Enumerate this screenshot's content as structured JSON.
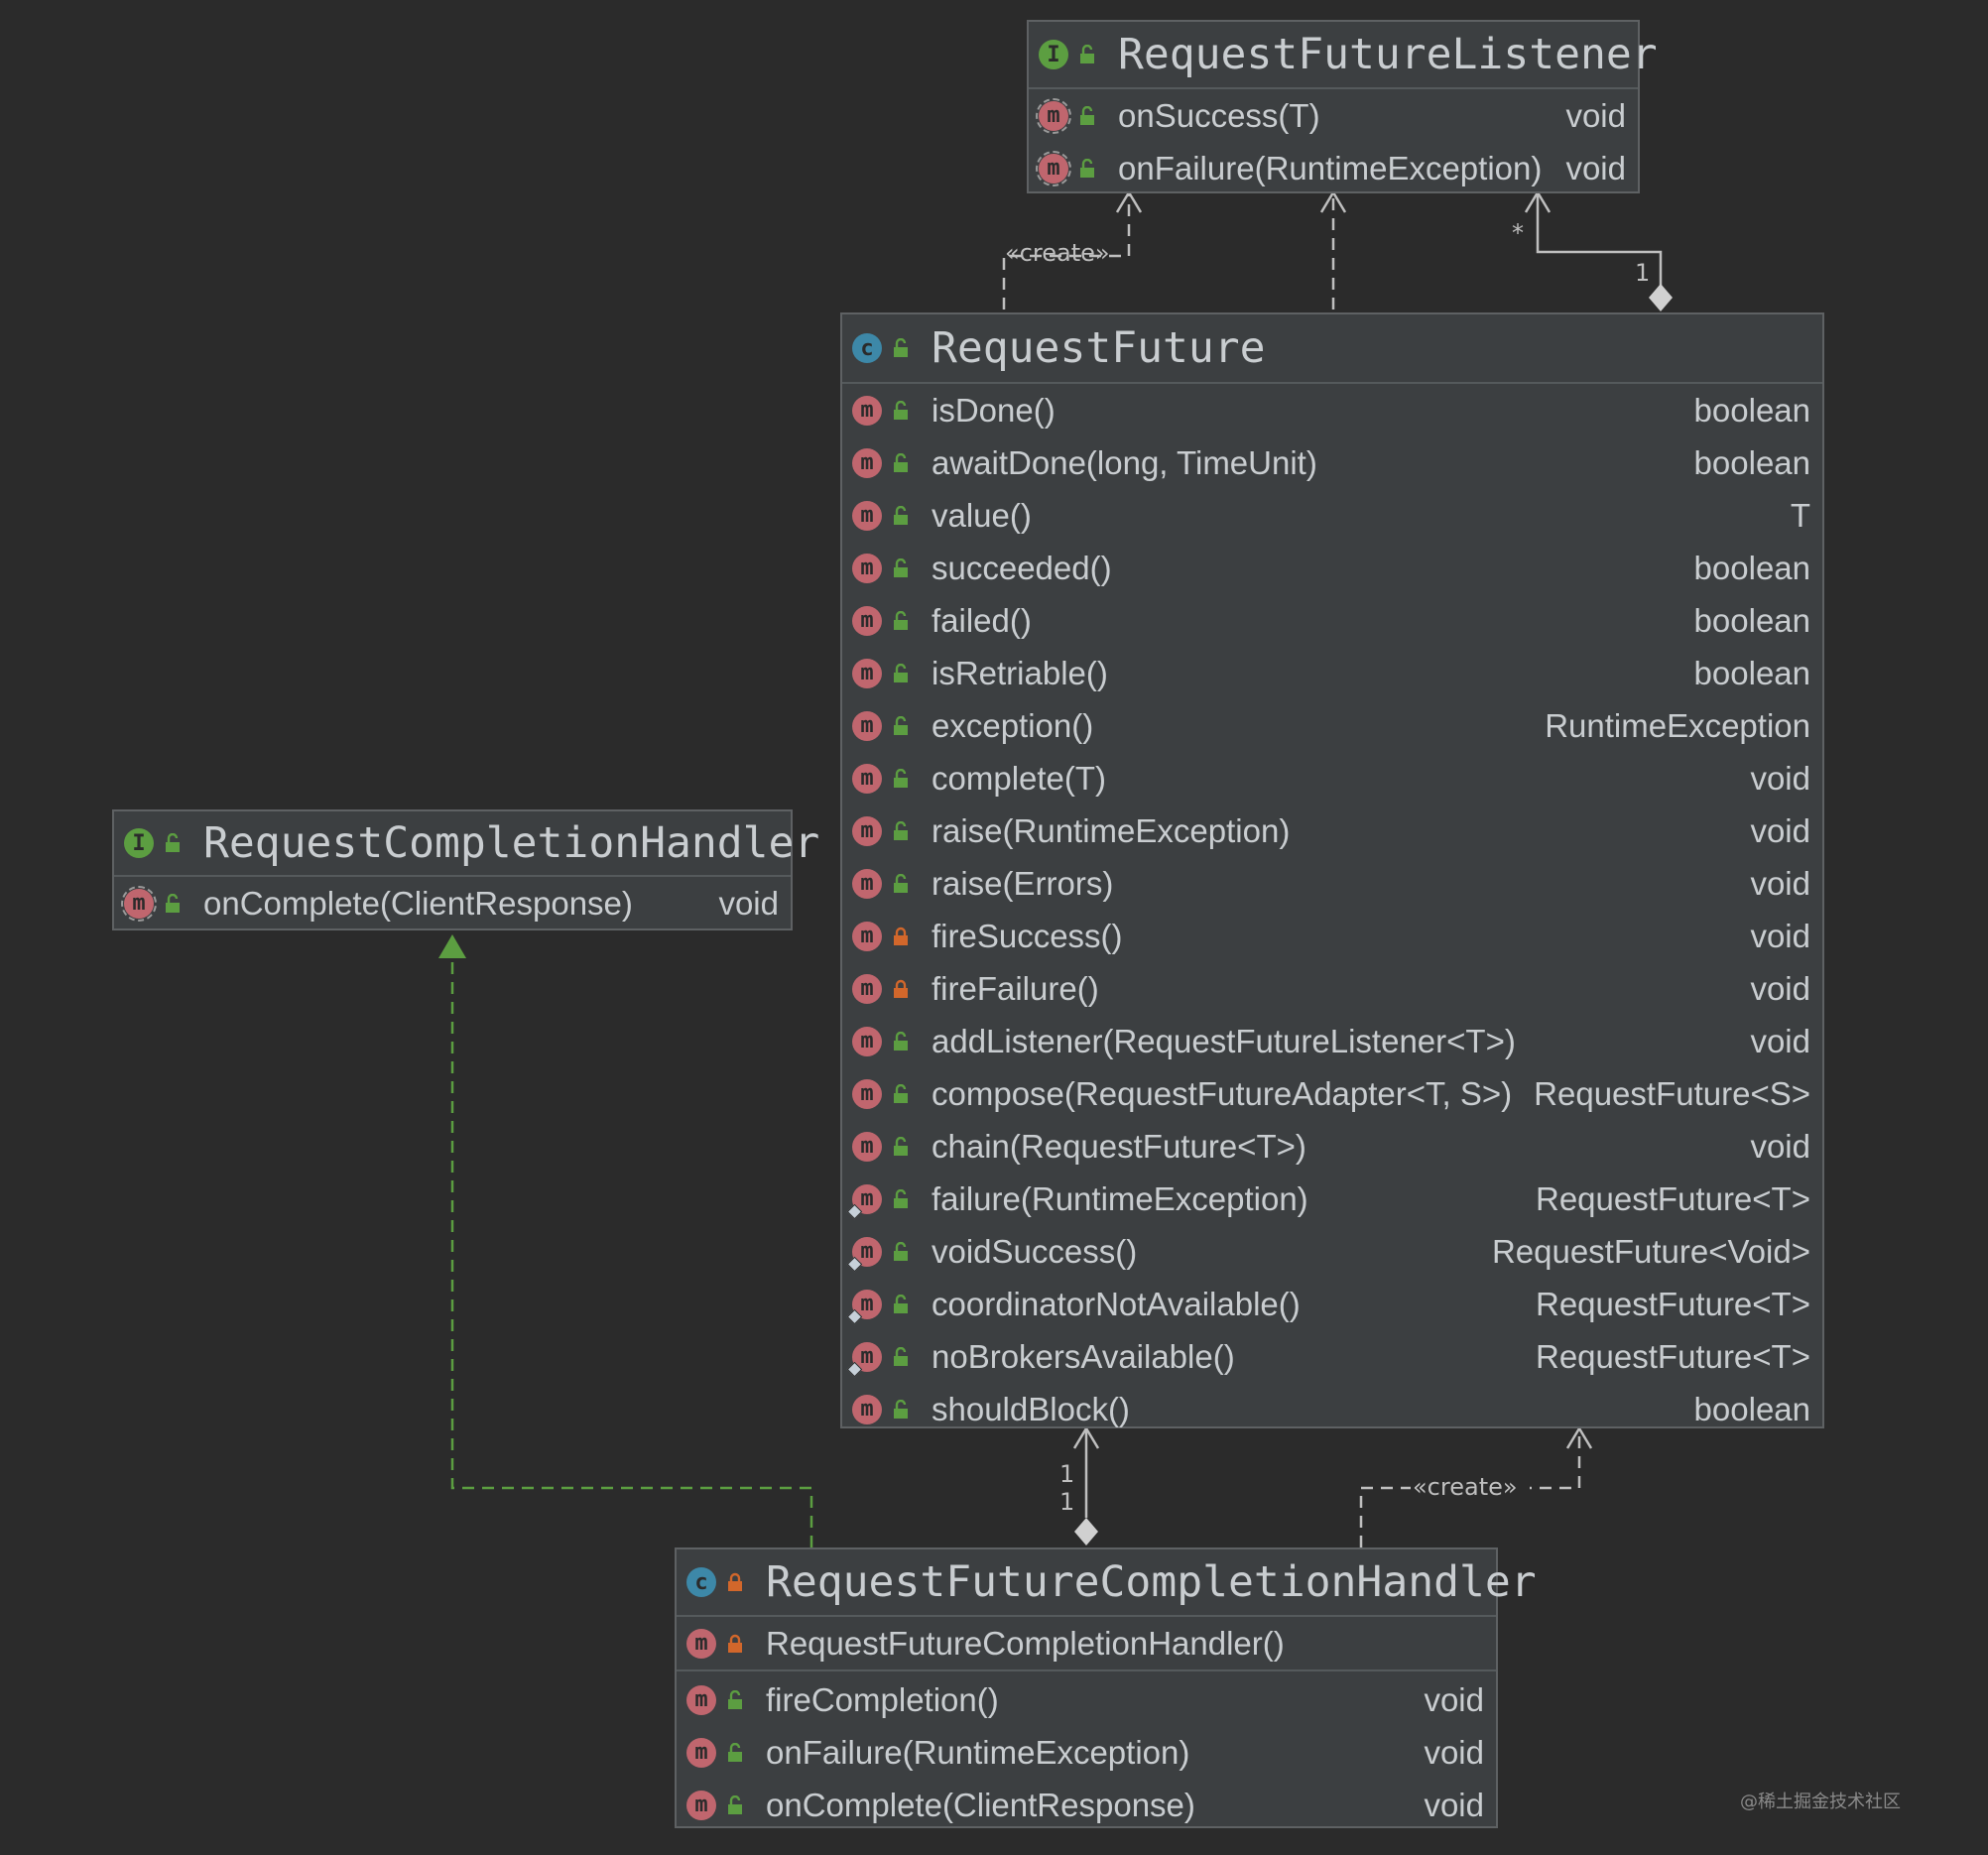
{
  "classes": {
    "listener": {
      "kind": "I",
      "name": "RequestFutureListener",
      "methods": [
        {
          "name": "onSuccess(T)",
          "type": "void",
          "vis": "public",
          "abstract": true
        },
        {
          "name": "onFailure(RuntimeException)",
          "type": "void",
          "vis": "public",
          "abstract": true
        }
      ]
    },
    "future": {
      "kind": "C",
      "name": "RequestFuture",
      "methods": [
        {
          "name": "isDone()",
          "type": "boolean",
          "vis": "public"
        },
        {
          "name": "awaitDone(long, TimeUnit)",
          "type": "boolean",
          "vis": "public"
        },
        {
          "name": "value()",
          "type": "T",
          "vis": "public"
        },
        {
          "name": "succeeded()",
          "type": "boolean",
          "vis": "public"
        },
        {
          "name": "failed()",
          "type": "boolean",
          "vis": "public"
        },
        {
          "name": "isRetriable()",
          "type": "boolean",
          "vis": "public"
        },
        {
          "name": "exception()",
          "type": "RuntimeException",
          "vis": "public"
        },
        {
          "name": "complete(T)",
          "type": "void",
          "vis": "public"
        },
        {
          "name": "raise(RuntimeException)",
          "type": "void",
          "vis": "public"
        },
        {
          "name": "raise(Errors)",
          "type": "void",
          "vis": "public"
        },
        {
          "name": "fireSuccess()",
          "type": "void",
          "vis": "private"
        },
        {
          "name": "fireFailure()",
          "type": "void",
          "vis": "private"
        },
        {
          "name": "addListener(RequestFutureListener<T>)",
          "type": "void",
          "vis": "public"
        },
        {
          "name": "compose(RequestFutureAdapter<T, S>)",
          "type": "RequestFuture<S>",
          "vis": "public"
        },
        {
          "name": "chain(RequestFuture<T>)",
          "type": "void",
          "vis": "public"
        },
        {
          "name": "failure(RuntimeException)",
          "type": "RequestFuture<T>",
          "vis": "public",
          "static": true
        },
        {
          "name": "voidSuccess()",
          "type": "RequestFuture<Void>",
          "vis": "public",
          "static": true
        },
        {
          "name": "coordinatorNotAvailable()",
          "type": "RequestFuture<T>",
          "vis": "public",
          "static": true
        },
        {
          "name": "noBrokersAvailable()",
          "type": "RequestFuture<T>",
          "vis": "public",
          "static": true
        },
        {
          "name": "shouldBlock()",
          "type": "boolean",
          "vis": "public"
        }
      ]
    },
    "handler": {
      "kind": "I",
      "name": "RequestCompletionHandler",
      "methods": [
        {
          "name": "onComplete(ClientResponse)",
          "type": "void",
          "vis": "public",
          "abstract": true
        }
      ]
    },
    "futureHandler": {
      "kind": "C",
      "name": "RequestFutureCompletionHandler",
      "constructor": {
        "name": "RequestFutureCompletionHandler()",
        "type": "",
        "vis": "private"
      },
      "methods": [
        {
          "name": "fireCompletion()",
          "type": "void",
          "vis": "public"
        },
        {
          "name": "onFailure(RuntimeException)",
          "type": "void",
          "vis": "public"
        },
        {
          "name": "onComplete(ClientResponse)",
          "type": "void",
          "vis": "public"
        }
      ]
    }
  },
  "edge_labels": {
    "create_top": "«create»",
    "create_bottom": "«create»",
    "mult_star": "*",
    "mult_one_top": "1",
    "mult_one_a": "1",
    "mult_one_b": "1"
  },
  "watermark": "@稀土掘金技术社区",
  "colors": {
    "background": "#2b2b2b",
    "box": "#3c3f41",
    "interface_badge": "#5c9e41",
    "class_badge": "#3d88a8",
    "method_badge": "#c0666e",
    "public_icon": "#5c9e41",
    "private_icon": "#d2672b",
    "realization_line": "#5c9e41",
    "dependency_line": "#bfbfbf"
  }
}
